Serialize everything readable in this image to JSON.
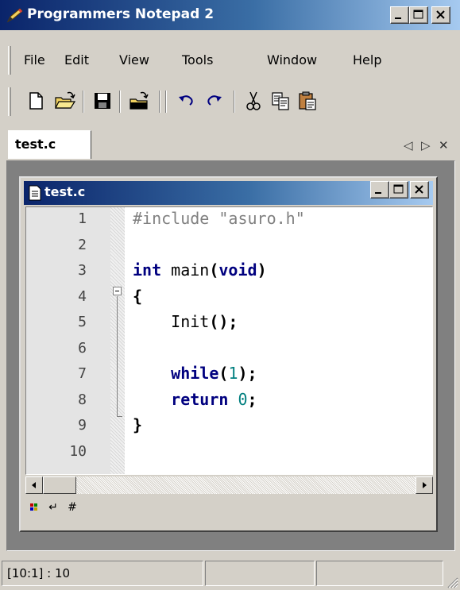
{
  "window": {
    "title": "Programmers Notepad 2"
  },
  "menu": {
    "items": [
      {
        "label": "File"
      },
      {
        "label": "Edit"
      },
      {
        "label": "View"
      },
      {
        "label": "Tools"
      },
      {
        "label": "Window"
      },
      {
        "label": "Help"
      }
    ]
  },
  "toolbar": {
    "buttons": [
      "new-file-icon",
      "open-folder-icon",
      "save-icon",
      "open-project-icon",
      "undo-icon",
      "redo-icon",
      "cut-icon",
      "copy-icon",
      "paste-icon"
    ]
  },
  "tabs": {
    "items": [
      {
        "label": "test.c"
      }
    ],
    "nav_prev": "◁",
    "nav_next": "▷",
    "nav_close": "✕"
  },
  "document": {
    "title": "test.c",
    "line_numbers": [
      "1",
      "2",
      "3",
      "4",
      "5",
      "6",
      "7",
      "8",
      "9",
      "10"
    ],
    "lines": [
      [
        {
          "t": "#include \"asuro.h\"",
          "c": "pp"
        }
      ],
      [],
      [
        {
          "t": "int",
          "c": "kw"
        },
        {
          "t": " main",
          "c": "ident"
        },
        {
          "t": "(",
          "c": "op"
        },
        {
          "t": "void",
          "c": "kw"
        },
        {
          "t": ")",
          "c": "op"
        }
      ],
      [
        {
          "t": "{",
          "c": "op"
        }
      ],
      [
        {
          "t": "    Init",
          "c": "ident"
        },
        {
          "t": "();",
          "c": "op"
        }
      ],
      [],
      [
        {
          "t": "    ",
          "c": "ident"
        },
        {
          "t": "while",
          "c": "kw"
        },
        {
          "t": "(",
          "c": "op"
        },
        {
          "t": "1",
          "c": "num"
        },
        {
          "t": ");",
          "c": "op"
        }
      ],
      [
        {
          "t": "    ",
          "c": "ident"
        },
        {
          "t": "return",
          "c": "kw"
        },
        {
          "t": " ",
          "c": "ident"
        },
        {
          "t": "0",
          "c": "num"
        },
        {
          "t": ";",
          "c": "op"
        }
      ],
      [
        {
          "t": "}",
          "c": "op"
        }
      ],
      []
    ]
  },
  "viewbar": {
    "wordwrap_glyph": "↵",
    "linenumbers_glyph": "#"
  },
  "status": {
    "position": "[10:1] : 10",
    "panel2": "",
    "panel3": ""
  },
  "colors": {
    "titlebar_start": "#0a246a",
    "titlebar_end": "#a6caf0",
    "preprocessor": "#808080",
    "keyword": "#00007f",
    "number": "#007f7f"
  }
}
